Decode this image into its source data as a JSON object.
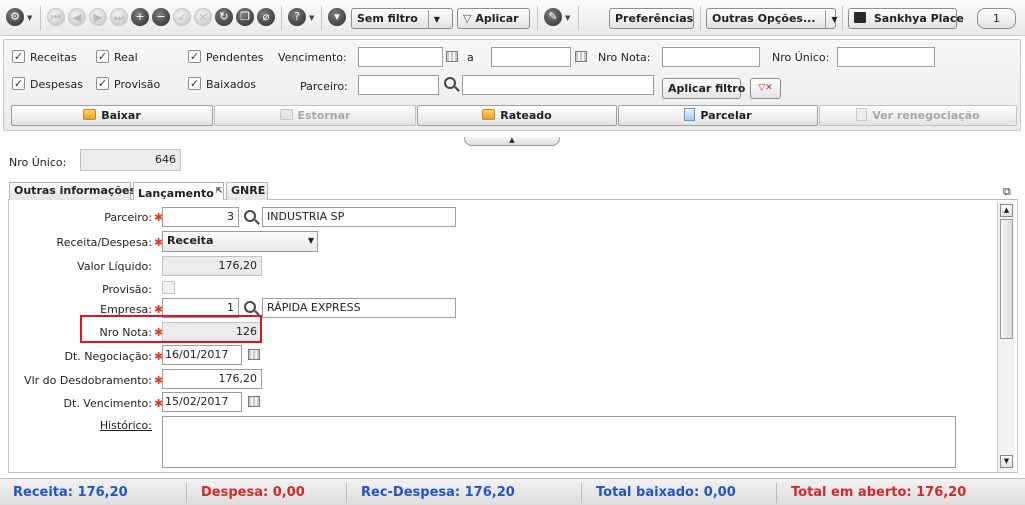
{
  "toolbar": {
    "filter_label": "Sem filtro",
    "apply_label": "Aplicar",
    "prefs_label": "Preferências",
    "more_label": "Outras Opções...",
    "place_label": "Sankhya Place",
    "page_value": "1"
  },
  "filters": {
    "receitas": "Receitas",
    "real": "Real",
    "pendentes": "Pendentes",
    "despesas": "Despesas",
    "provisao": "Provisão",
    "baixados": "Baixados",
    "vencimento": "Vencimento:",
    "a": "a",
    "nro_nota": "Nro Nota:",
    "nro_unico": "Nro Único:",
    "parceiro": "Parceiro:",
    "apply_filter": "Aplicar filtro",
    "check": "✓"
  },
  "actions": {
    "baixar": "Baixar",
    "estornar": "Estornar",
    "rateado": "Rateado",
    "parcelar": "Parcelar",
    "ver_renegociacao": "Ver renegociação"
  },
  "record": {
    "nro_unico_label": "Nro Único:",
    "nro_unico_value": "646"
  },
  "tabs": [
    "Outras informações",
    "Lançamento",
    "GNRE"
  ],
  "form": {
    "parceiro_label": "Parceiro:",
    "parceiro_code": "3",
    "parceiro_name": "INDUSTRIA SP",
    "receita_despesa_label": "Receita/Despesa:",
    "receita_despesa_value": "Receita",
    "valor_liquido_label": "Valor Líquido:",
    "valor_liquido_value": "176,20",
    "provisao_label": "Provisão:",
    "empresa_label": "Empresa:",
    "empresa_code": "1",
    "empresa_name": "RÁPIDA EXPRESS",
    "nro_nota_label": "Nro Nota:",
    "nro_nota_value": "126",
    "dt_negociacao_label": "Dt. Negociação:",
    "dt_negociacao_value": "16/01/2017",
    "vlr_desdobramento_label": "Vlr do Desdobramento:",
    "vlr_desdobramento_value": "176,20",
    "dt_vencimento_label": "Dt. Vencimento:",
    "dt_vencimento_value": "15/02/2017",
    "historico_label": "Histórico:",
    "required_mark": "✱"
  },
  "totals": {
    "receita": "Receita: 176,20",
    "despesa": "Despesa: 0,00",
    "rec_despesa": "Rec-Despesa: 176,20",
    "total_baixado": "Total baixado: 0,00",
    "total_aberto": "Total em aberto: 176,20"
  },
  "colors": {
    "required": "#d93b2a",
    "highlight": "#e0141e",
    "total_blue": "#2255cc",
    "total_red": "#d62828"
  }
}
